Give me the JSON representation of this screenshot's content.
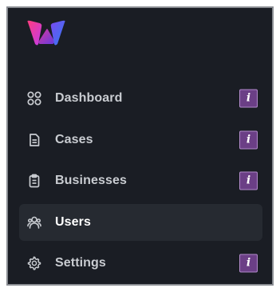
{
  "brand": {
    "logo_icon": "w-logo-icon",
    "colors": [
      "#f0357e",
      "#8b3df0",
      "#3b8af0"
    ]
  },
  "nav": {
    "items": [
      {
        "label": "Dashboard",
        "icon": "grid-icon",
        "info": "i",
        "active": false
      },
      {
        "label": "Cases",
        "icon": "document-icon",
        "info": "i",
        "active": false
      },
      {
        "label": "Businesses",
        "icon": "clipboard-icon",
        "info": "i",
        "active": false
      },
      {
        "label": "Users",
        "icon": "users-icon",
        "active": true
      },
      {
        "label": "Settings",
        "icon": "gear-icon",
        "info": "i",
        "active": false
      }
    ]
  },
  "colors": {
    "sidebar_bg": "#1a1d24",
    "active_item_bg": "#262a31",
    "text": "#c9ccd1",
    "badge_bg": "#6b3f86",
    "badge_border": "#b28acb"
  }
}
